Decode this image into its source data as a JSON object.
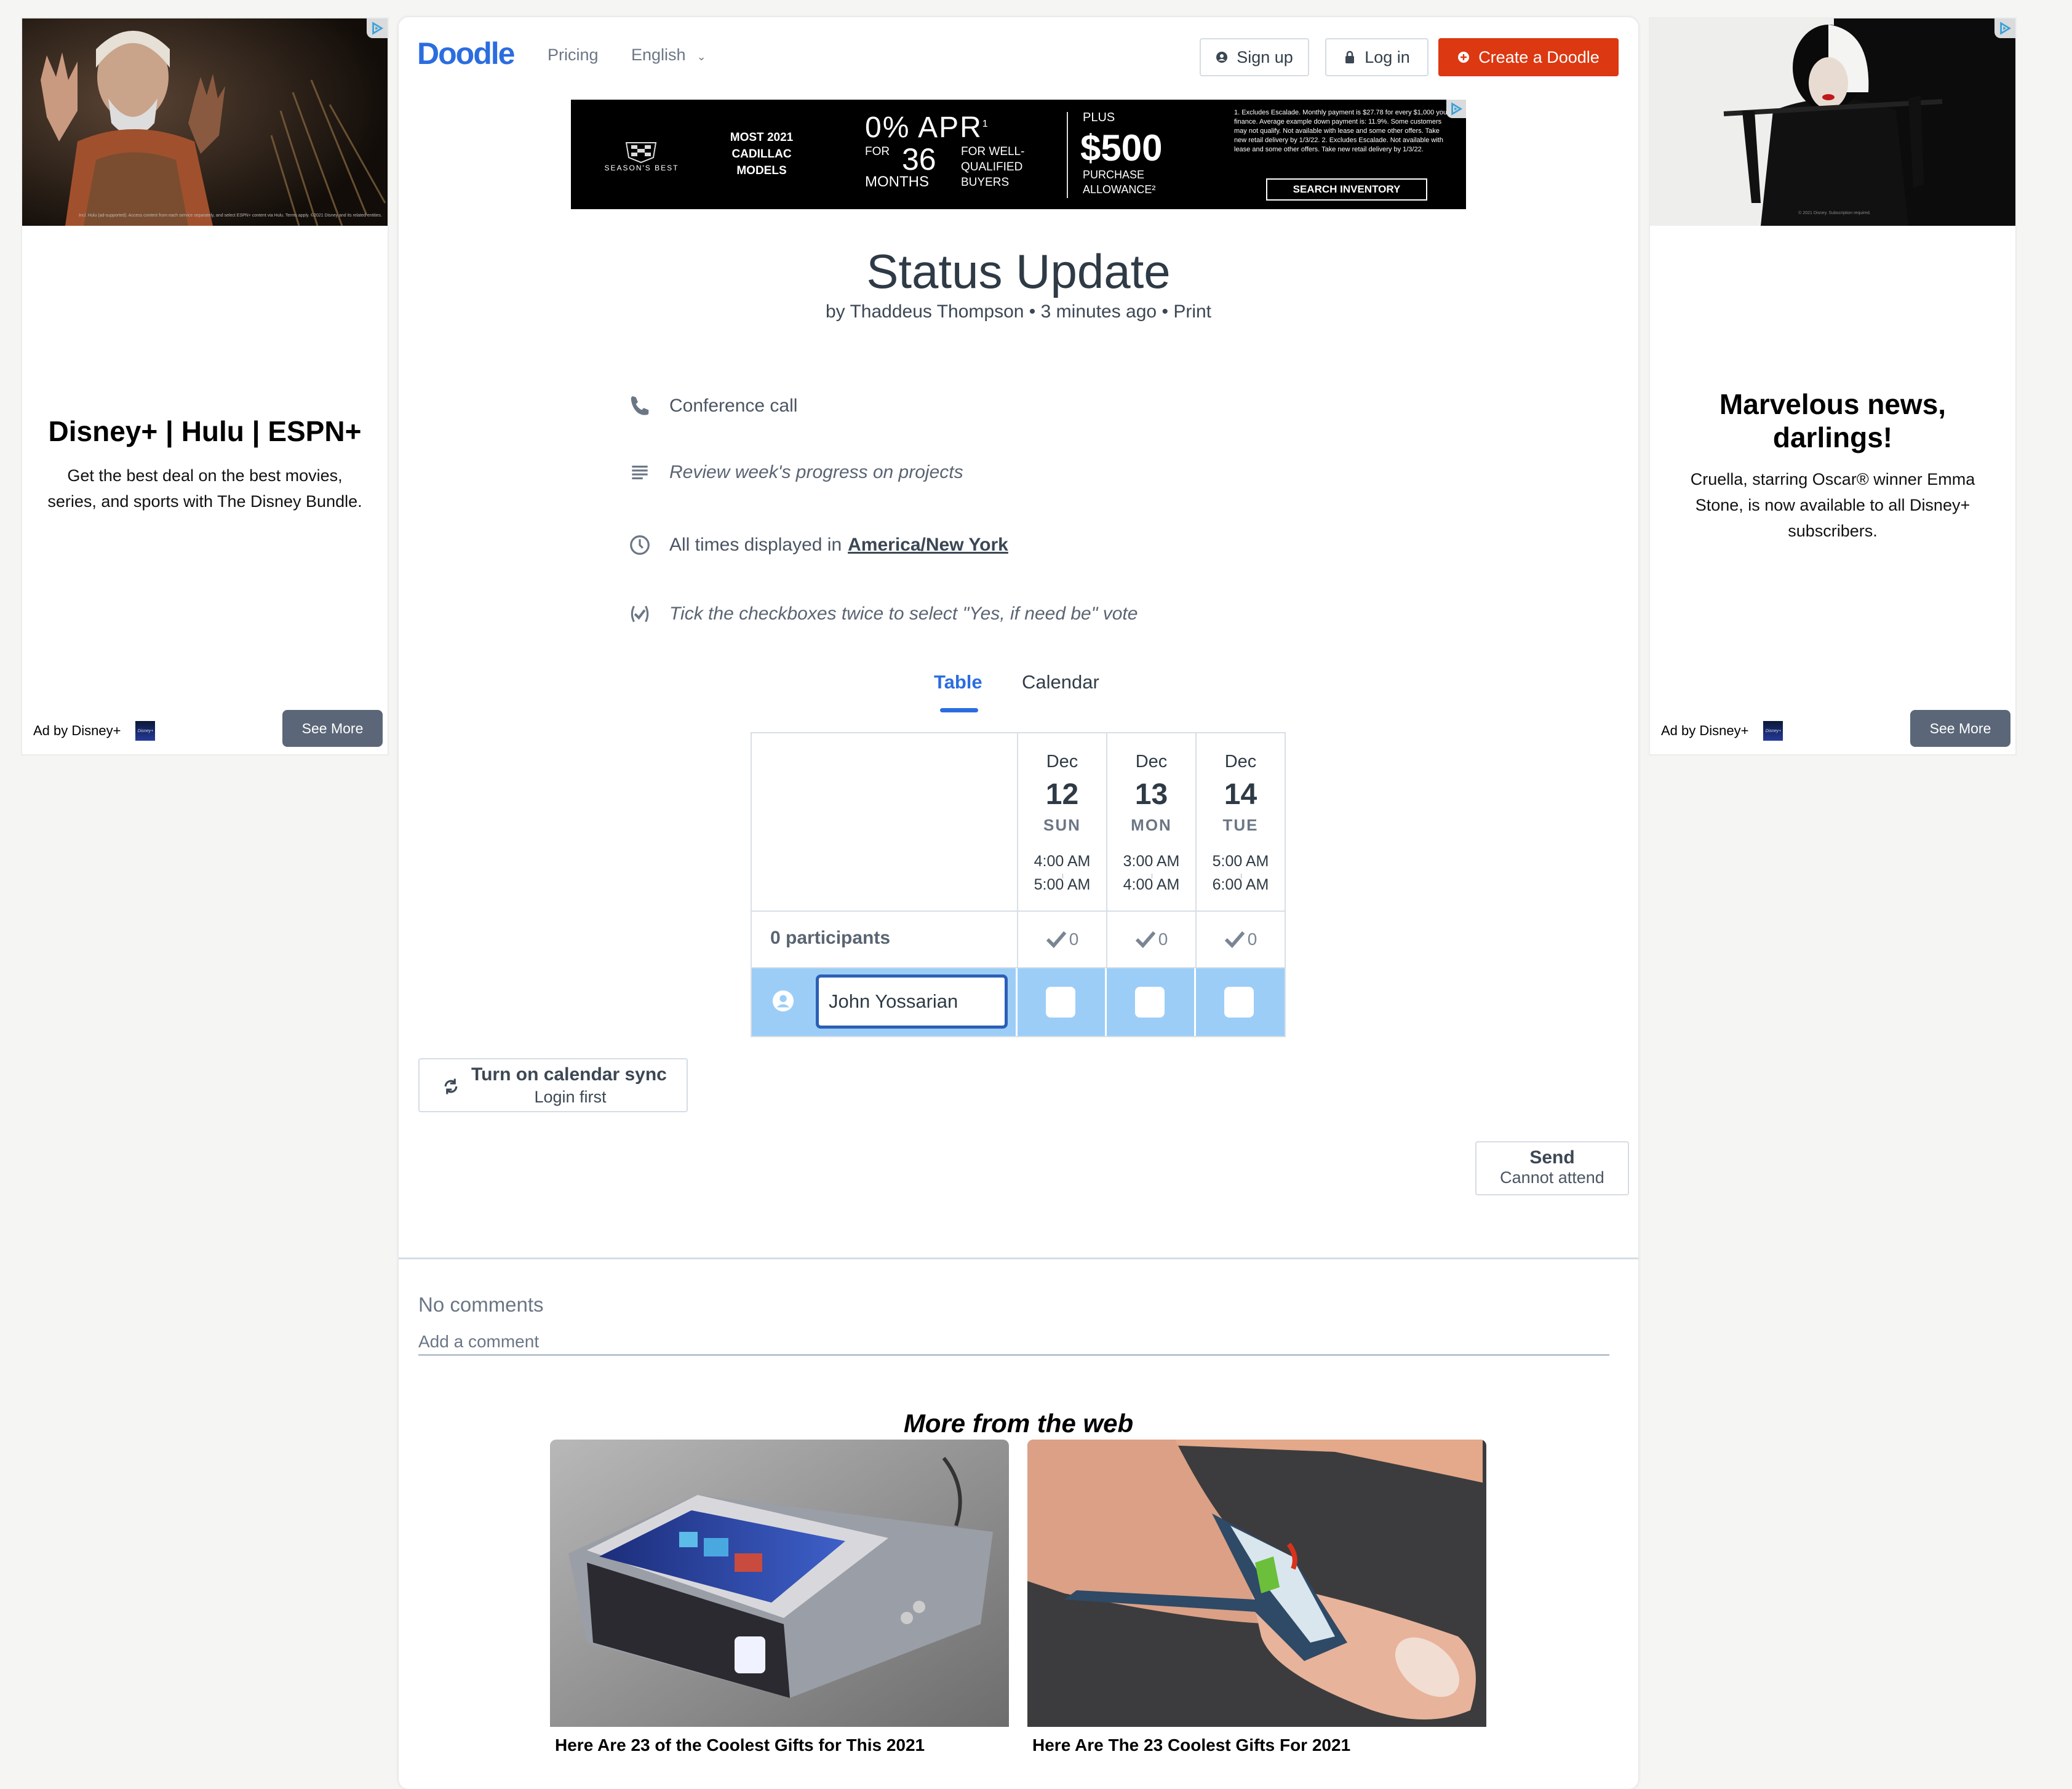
{
  "left_ad": {
    "title": "Disney+ | Hulu | ESPN+",
    "body": "Get the best deal on the best movies, series, and sports with The Disney Bundle.",
    "fine_print": "Incl. Hulu (ad-supported). Access content from each service separately, and select ESPN+ content via Hulu. Terms apply. ©2021 Disney and its related entities.",
    "ad_by": "Ad by Disney+",
    "logo_text": "Disney+",
    "cta": "See More"
  },
  "right_ad": {
    "title": "Marvelous news, darlings!",
    "body": "Cruella, starring Oscar® winner Emma Stone, is now available to all Disney+ subscribers.",
    "fine_print": "© 2021 Disney. Subscription required.",
    "ad_by": "Ad by Disney+",
    "logo_text": "Disney+",
    "cta": "See More"
  },
  "header": {
    "logo": "Doodle",
    "nav": {
      "pricing": "Pricing",
      "language": "English"
    },
    "buttons": {
      "signup": "Sign up",
      "login": "Log in",
      "create": "Create a Doodle"
    }
  },
  "banner_ad": {
    "brand_tag": "SEASON'S BEST",
    "models": [
      "MOST 2021",
      "CADILLAC",
      "MODELS"
    ],
    "apr": "0% APR",
    "apr_sup": "1",
    "for": "FOR",
    "months_num": "36",
    "months": "MONTHS",
    "qualified": [
      "FOR WELL-",
      "QUALIFIED",
      "BUYERS"
    ],
    "plus": "PLUS",
    "allowance_amount": "$500",
    "allowance": [
      "PURCHASE",
      "ALLOWANCE²"
    ],
    "disclaimer": "1. Excludes Escalade. Monthly payment is $27.78 for every $1,000 you finance. Average example down payment is: 11.9%. Some customers may not qualify. Not available with lease and some other offers. Take new retail delivery by 1/3/22.     2. Excludes Escalade. Not available with lease and some other offers. Take new retail delivery by 1/3/22.",
    "cta": "SEARCH INVENTORY"
  },
  "poll": {
    "title": "Status Update",
    "author_prefix": "by",
    "author": "Thaddeus Thompson",
    "time": "3 minutes ago",
    "print": "Print",
    "location": "Conference call",
    "description": "Review week's progress on projects",
    "timezone_prefix": "All times displayed in",
    "timezone": "America/New York",
    "hint": "Tick the checkboxes twice to select \"Yes, if need be\" vote"
  },
  "tabs": [
    {
      "label": "Table",
      "active": true
    },
    {
      "label": "Calendar",
      "active": false
    }
  ],
  "table": {
    "options": [
      {
        "month": "Dec",
        "day": "12",
        "weekday": "SUN",
        "start": "4:00 AM",
        "end": "5:00 AM",
        "yes_count": "0",
        "checked": false
      },
      {
        "month": "Dec",
        "day": "13",
        "weekday": "MON",
        "start": "3:00 AM",
        "end": "4:00 AM",
        "yes_count": "0",
        "checked": false
      },
      {
        "month": "Dec",
        "day": "14",
        "weekday": "TUE",
        "start": "5:00 AM",
        "end": "6:00 AM",
        "yes_count": "0",
        "checked": false
      }
    ],
    "participants_label": "0 participants",
    "name_input_value": "John Yossarian"
  },
  "calendar_sync": {
    "title": "Turn on calendar sync",
    "subtitle": "Login first"
  },
  "send": {
    "title": "Send",
    "subtitle": "Cannot attend"
  },
  "comments": {
    "empty": "No comments",
    "placeholder": "Add a comment"
  },
  "more_from_web": {
    "heading": "More from the web",
    "items": [
      {
        "caption": "Here Are 23 of the Coolest Gifts for This 2021"
      },
      {
        "caption": "Here Are The 23 Coolest Gifts For 2021"
      }
    ]
  },
  "colors": {
    "brand_blue": "#2b6de0",
    "create_red": "#dc3811",
    "row_highlight": "#9ccdf7",
    "input_border": "#2b5fb6"
  }
}
